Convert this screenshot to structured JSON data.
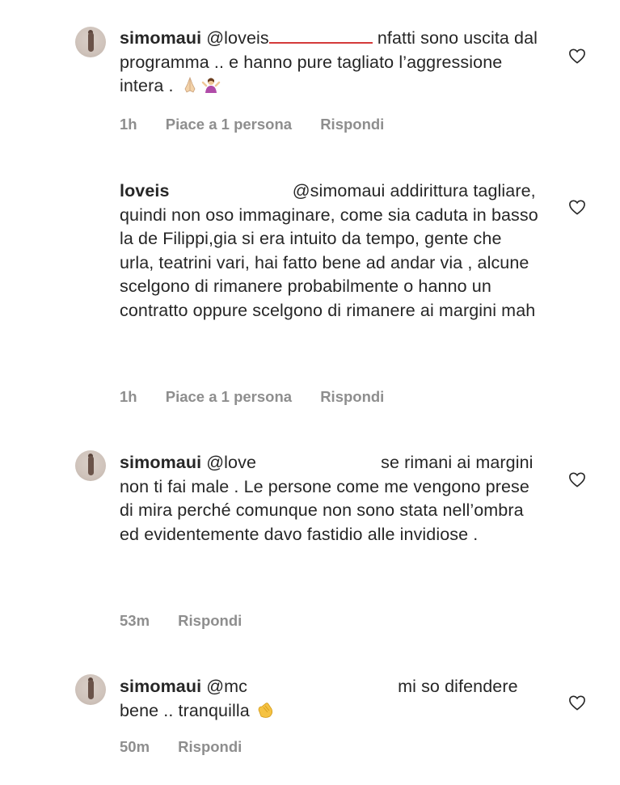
{
  "comments": [
    {
      "username": "simomaui",
      "mention": "@loveis",
      "text_start": "nfatti sono",
      "text_rest": "uscita dal programma .. e hanno pure tagliato l’aggressione intera . ",
      "emojis": [
        "folded-hands-emoji",
        "person-shrugging-emoji"
      ],
      "time": "1h",
      "likes": "Piace a 1 persona",
      "reply": "Rispondi"
    },
    {
      "username": "loveis",
      "mention": "@simomaui",
      "text_start": "addirittura",
      "text_rest": "tagliare, quindi non oso immaginare, come sia caduta in basso la de Filippi,gia si era intuito da tempo, gente che urla, teatrini vari, hai fatto bene ad andar via , alcune scelgono di rimanere probabilmente o hanno un contratto oppure scelgono di rimanere ai margini mah",
      "time": "1h",
      "likes": "Piace a 1 persona",
      "reply": "Rispondi"
    },
    {
      "username": "simomaui",
      "mention": "@love",
      "text_start": "se rimani ai",
      "text_rest": "margini non ti fai male . Le persone come me vengono prese di mira perché comunque non sono stata nell’ombra ed evidentemente davo fastidio alle invidiose .",
      "time": "53m",
      "reply": "Rispondi"
    },
    {
      "username": "simomaui",
      "mention": "@mc",
      "text_start": "mi so",
      "text_rest": "difendere bene .. tranquilla ",
      "emojis": [
        "clapping-hands-emoji"
      ],
      "time": "50m",
      "reply": "Rispondi"
    }
  ],
  "icons": {
    "like": "heart-outline-icon"
  },
  "colors": {
    "text": "#262626",
    "meta": "#8e8e8e",
    "redaction_line": "#d43a3a"
  }
}
